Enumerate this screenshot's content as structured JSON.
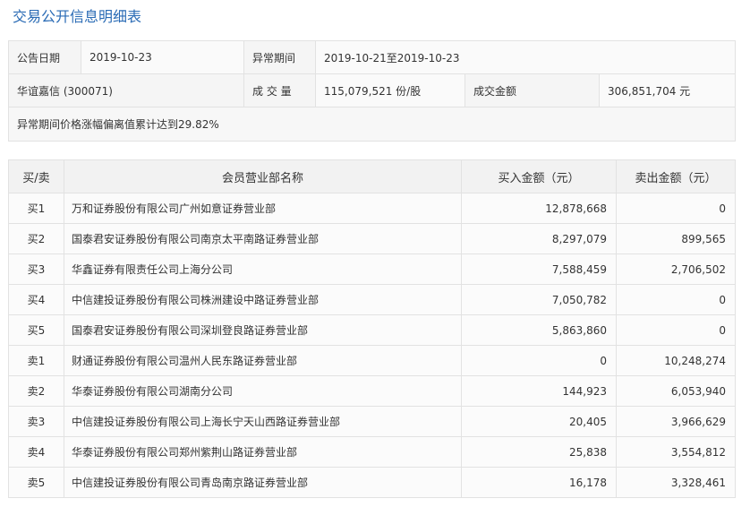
{
  "page": {
    "title": "交易公开信息明细表"
  },
  "info": {
    "announce_date_label": "公告日期",
    "announce_date": "2019-10-23",
    "abnormal_period_label": "异常期间",
    "abnormal_period": "2019-10-21至2019-10-23",
    "stock": "华谊嘉信 (300071)",
    "volume_label": "成 交 量",
    "volume": "115,079,521 份/股",
    "amount_label": "成交金额",
    "amount": "306,851,704 元",
    "reason": "异常期间价格涨幅偏离值累计达到29.82%"
  },
  "detail": {
    "headers": {
      "side": "买/卖",
      "name": "会员营业部名称",
      "buy": "买入金额（元）",
      "sell": "卖出金额（元）"
    },
    "rows": [
      {
        "side": "买1",
        "name": "万和证券股份有限公司广州如意证券营业部",
        "buy": "12,878,668",
        "sell": "0"
      },
      {
        "side": "买2",
        "name": "国泰君安证券股份有限公司南京太平南路证券营业部",
        "buy": "8,297,079",
        "sell": "899,565"
      },
      {
        "side": "买3",
        "name": "华鑫证券有限责任公司上海分公司",
        "buy": "7,588,459",
        "sell": "2,706,502"
      },
      {
        "side": "买4",
        "name": "中信建投证券股份有限公司株洲建设中路证券营业部",
        "buy": "7,050,782",
        "sell": "0"
      },
      {
        "side": "买5",
        "name": "国泰君安证券股份有限公司深圳登良路证券营业部",
        "buy": "5,863,860",
        "sell": "0"
      },
      {
        "side": "卖1",
        "name": "财通证券股份有限公司温州人民东路证券营业部",
        "buy": "0",
        "sell": "10,248,274"
      },
      {
        "side": "卖2",
        "name": "华泰证券股份有限公司湖南分公司",
        "buy": "144,923",
        "sell": "6,053,940"
      },
      {
        "side": "卖3",
        "name": "中信建投证券股份有限公司上海长宁天山西路证券营业部",
        "buy": "20,405",
        "sell": "3,966,629"
      },
      {
        "side": "卖4",
        "name": "华泰证券股份有限公司郑州紫荆山路证券营业部",
        "buy": "25,838",
        "sell": "3,554,812"
      },
      {
        "side": "卖5",
        "name": "中信建投证券股份有限公司青岛南京路证券营业部",
        "buy": "16,178",
        "sell": "3,328,461"
      }
    ]
  }
}
